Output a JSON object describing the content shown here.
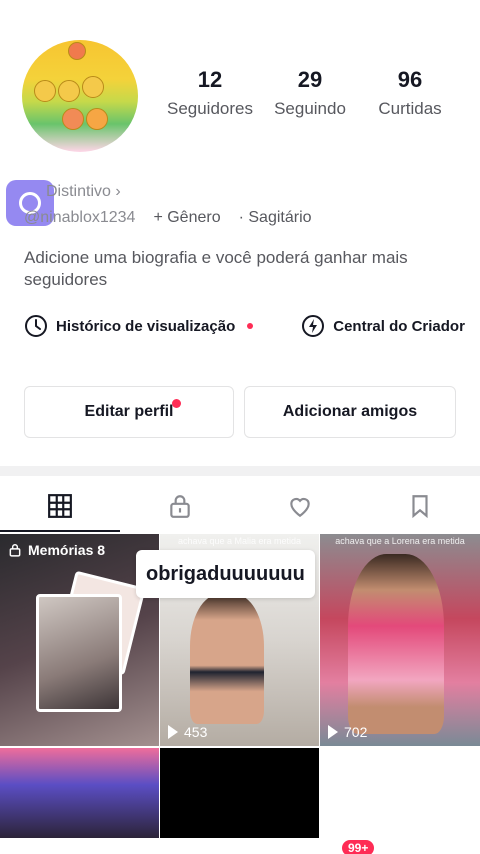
{
  "profile": {
    "followers_count": "12",
    "followers_label": "Seguidores",
    "following_count": "29",
    "following_label": "Seguindo",
    "likes_count": "96",
    "likes_label": "Curtidas",
    "badge_label": "Distintivo ›",
    "username": "@ninablox1234",
    "gender_label": "+ Gênero",
    "zodiac_label": "· Sagitário",
    "bio": "Adicione uma biografia e você poderá ganhar mais seguidores"
  },
  "links": {
    "history_label": "Histórico de visualização",
    "creator_label": "Central do Criador"
  },
  "buttons": {
    "edit_profile": "Editar perfil",
    "add_friends": "Adicionar amigos"
  },
  "tabs": [
    {
      "icon": "grid-icon",
      "active": true
    },
    {
      "icon": "lock-icon",
      "active": false
    },
    {
      "icon": "heart-icon",
      "active": false
    },
    {
      "icon": "bookmark-icon",
      "active": false
    }
  ],
  "grid": {
    "memories_label": "Memórias 8",
    "video2_views": "453",
    "video2_caption": "achava que a Malia era metida",
    "video3_views": "702",
    "video3_caption": "achava que a Lorena era metida"
  },
  "tooltip": "obrigaduuuuuuu",
  "nav": {
    "notification_badge": "99+"
  },
  "colors": {
    "accent": "#fe2c55",
    "text_primary": "#161823",
    "text_secondary": "#57585e"
  }
}
